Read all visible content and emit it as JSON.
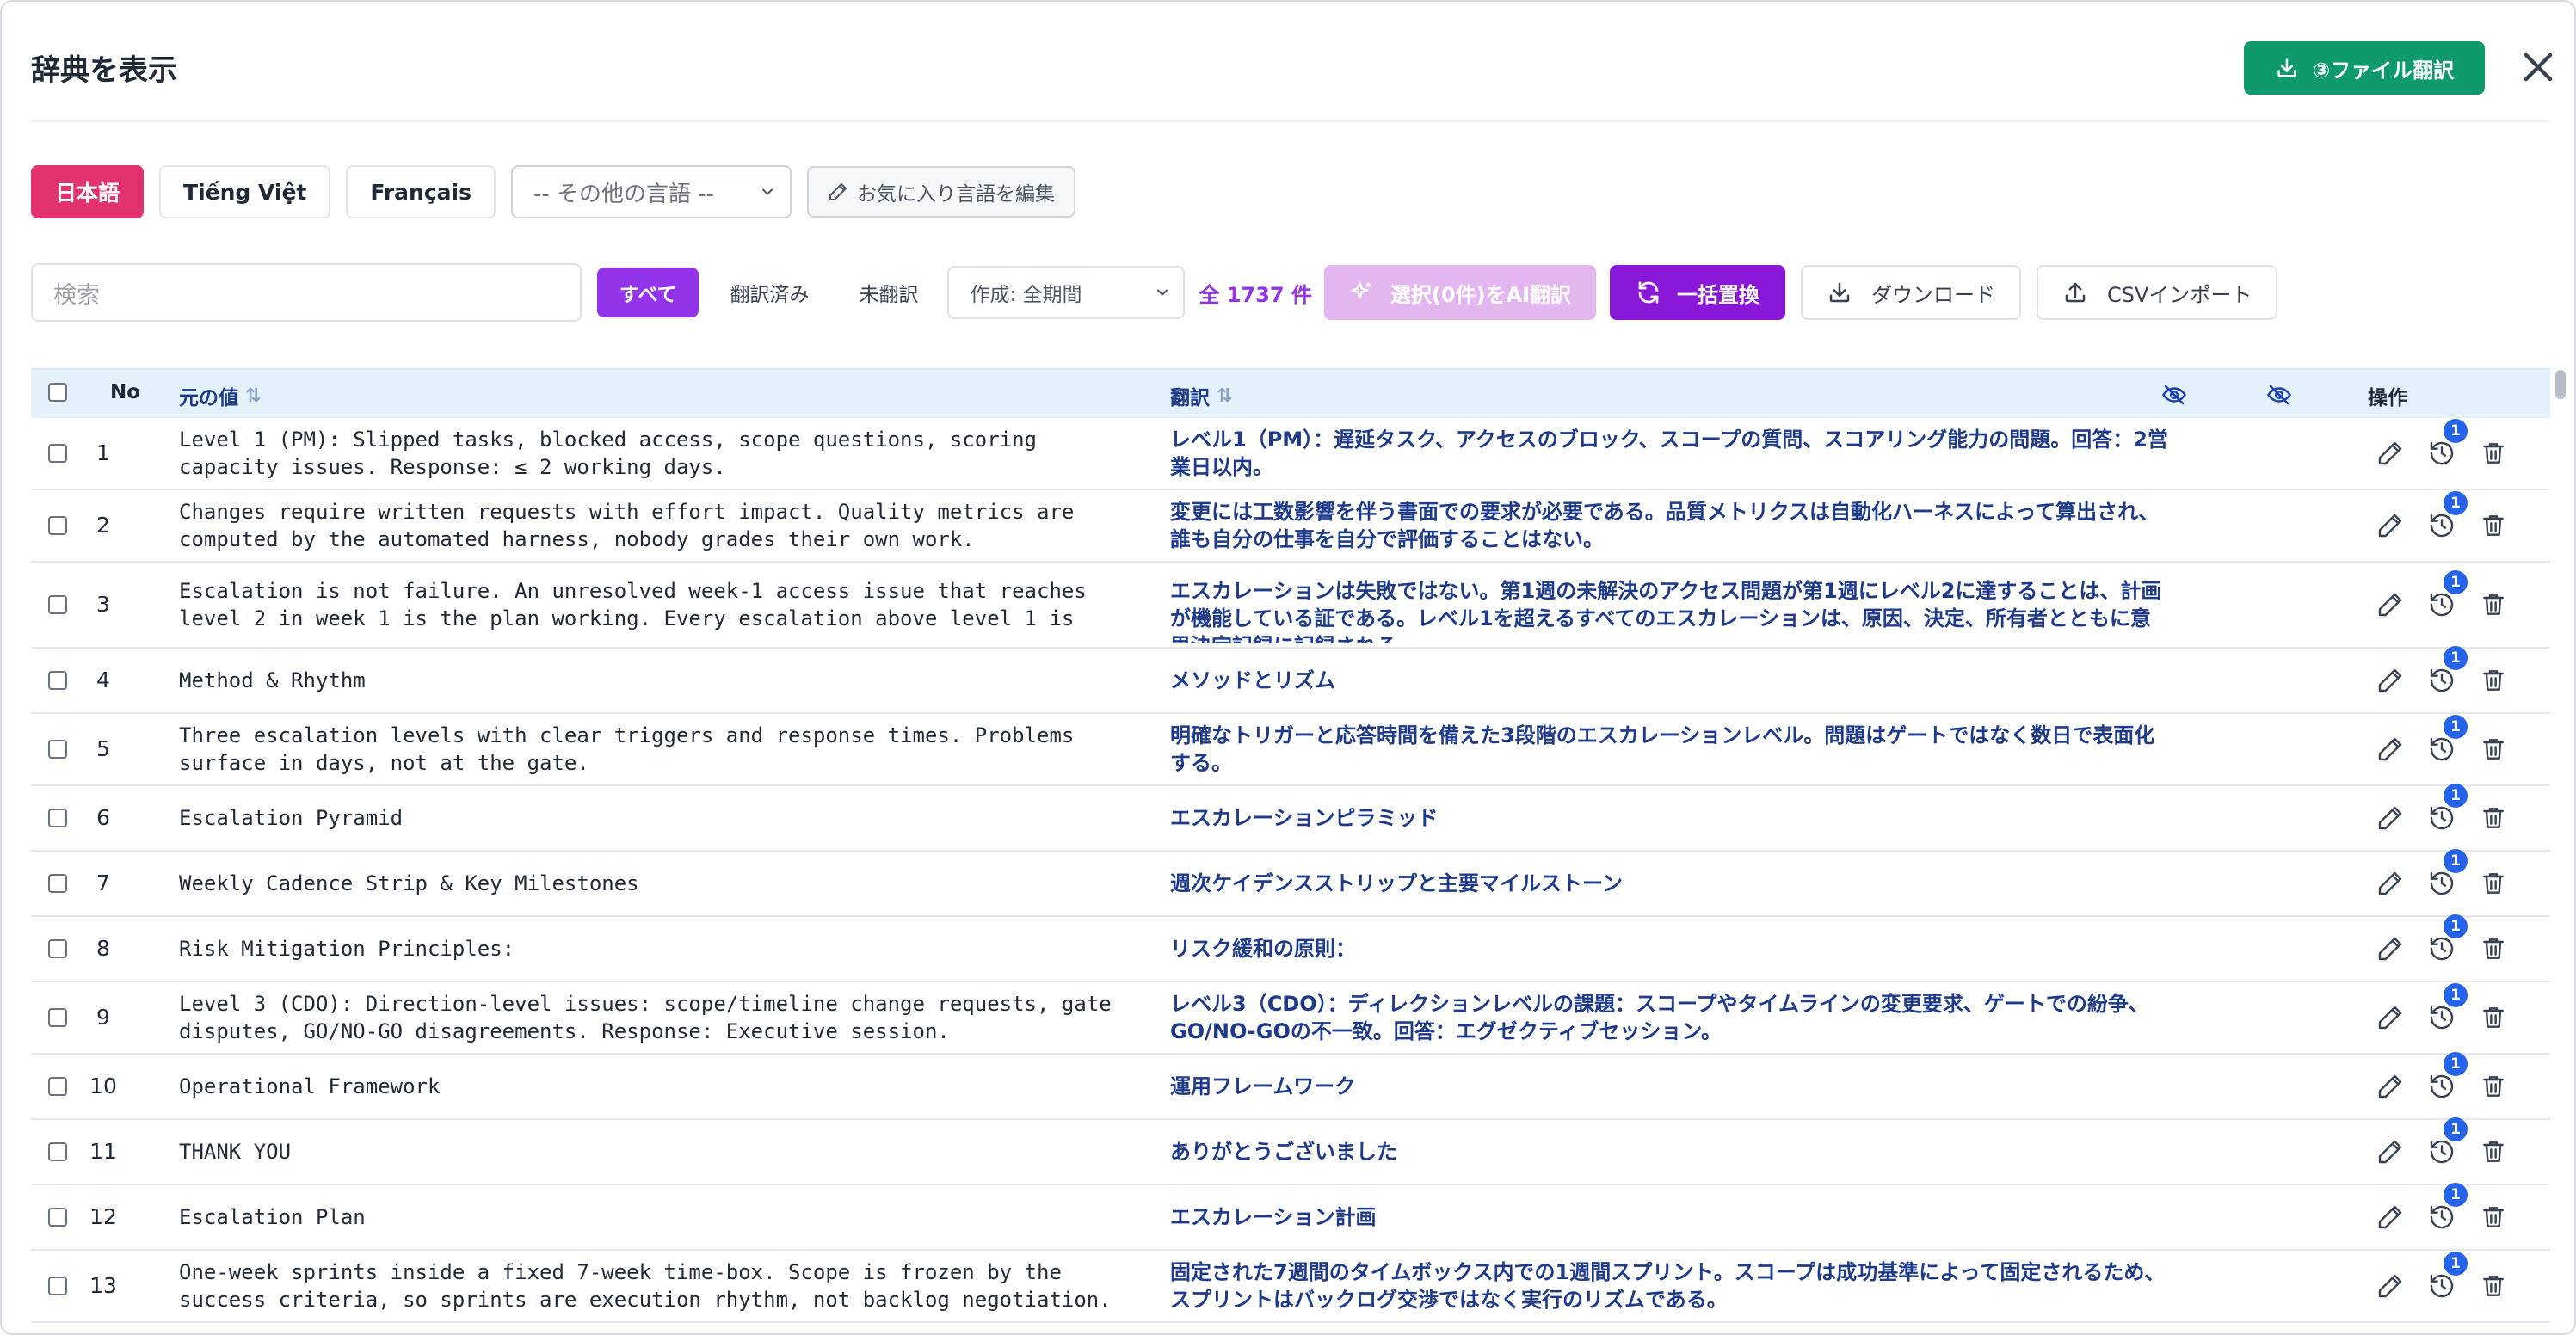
{
  "header": {
    "title": "辞典を表示",
    "file_translate_label": "③ファイル翻訳"
  },
  "languages": {
    "tabs": [
      "日本語",
      "Tiếng Việt",
      "Français"
    ],
    "active_index": 0,
    "other_select": "-- その他の言語 --",
    "edit_favorites_label": "お気に入り言語を編集"
  },
  "toolbar": {
    "search_placeholder": "検索",
    "filters": [
      "すべて",
      "翻訳済み",
      "未翻訳"
    ],
    "period_select": "作成: 全期間",
    "count": "全 1737 件",
    "ai_translate_label": "選択(0件)をAI翻訳",
    "bulk_replace_label": "一括置換",
    "download_label": "ダウンロード",
    "csv_import_label": "CSVインポート"
  },
  "table": {
    "columns": {
      "no": "No",
      "source": "元の値",
      "translation": "翻訳",
      "actions": "操作"
    },
    "rows": [
      {
        "no": "1",
        "source": "Level 1 (PM): Slipped tasks, blocked access, scope questions, scoring\ncapacity issues. Response: ≤ 2 working days.",
        "translation": "レベル1（PM）：遅延タスク、アクセスのブロック、スコープの質問、スコアリング能力の問題。回答：2営業日以内。",
        "badge": "1"
      },
      {
        "no": "2",
        "source": "Changes require written requests with effort impact. Quality metrics are\ncomputed by the automated harness, nobody grades their own work.",
        "translation": "変更には工数影響を伴う書面での要求が必要である。品質メトリクスは自動化ハーネスによって算出され、誰も自分の仕事を自分で評価することはない。",
        "badge": "1"
      },
      {
        "no": "3",
        "source": "Escalation is not failure. An unresolved week-1 access issue that reaches\nlevel 2 in week 1 is the plan working. Every escalation above level 1 is",
        "translation": "エスカレーションは失敗ではない。第1週の未解決のアクセス問題が第1週にレベル2に達することは、計画が機能している証である。レベル1を超えるすべてのエスカレーションは、原因、決定、所有者とともに意思決定記録に記録される。",
        "badge": "1"
      },
      {
        "no": "4",
        "source": "Method & Rhythm",
        "translation": "メソッドとリズム",
        "badge": "1"
      },
      {
        "no": "5",
        "source": "Three escalation levels with clear triggers and response times. Problems\nsurface in days, not at the gate.",
        "translation": "明確なトリガーと応答時間を備えた3段階のエスカレーションレベル。問題はゲートではなく数日で表面化する。",
        "badge": "1"
      },
      {
        "no": "6",
        "source": "Escalation Pyramid",
        "translation": "エスカレーションピラミッド",
        "badge": "1"
      },
      {
        "no": "7",
        "source": "Weekly Cadence Strip & Key Milestones",
        "translation": "週次ケイデンスストリップと主要マイルストーン",
        "badge": "1"
      },
      {
        "no": "8",
        "source": "Risk Mitigation Principles:",
        "translation": "リスク緩和の原則：",
        "badge": "1"
      },
      {
        "no": "9",
        "source": "Level 3 (CDO): Direction-level issues: scope/timeline change requests, gate\ndisputes, GO/NO-GO disagreements. Response: Executive session.",
        "translation": "レベル3（CDO）：ディレクションレベルの課題：スコープやタイムラインの変更要求、ゲートでの紛争、GO/NO-GOの不一致。回答：エグゼクティブセッション。",
        "badge": "1"
      },
      {
        "no": "10",
        "source": "Operational Framework",
        "translation": "運用フレームワーク",
        "badge": "1"
      },
      {
        "no": "11",
        "source": "THANK YOU",
        "translation": "ありがとうございました",
        "badge": "1"
      },
      {
        "no": "12",
        "source": "Escalation Plan",
        "translation": "エスカレーション計画",
        "badge": "1"
      },
      {
        "no": "13",
        "source": "One-week sprints inside a fixed 7-week time-box. Scope is frozen by the\nsuccess criteria, so sprints are execution rhythm, not backlog negotiation.",
        "translation": "固定された7週間のタイムボックス内での1週間スプリント。スコープは成功基準によって固定されるため、スプリントはバックログ交渉ではなく実行のリズムである。",
        "badge": "1"
      }
    ]
  },
  "colors": {
    "primary_purple": "#9333ea",
    "language_active": "#e0336f",
    "file_translate_green": "#0f9a6e",
    "translation_text": "#1e3a8a",
    "badge_blue": "#2563eb"
  }
}
